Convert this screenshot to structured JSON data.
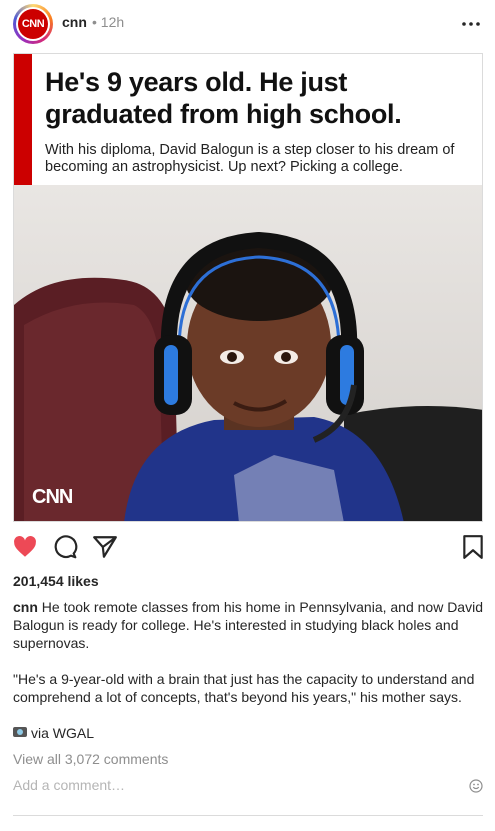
{
  "post": {
    "avatar_text": "CNN",
    "username": "cnn",
    "time": "• 12h"
  },
  "media": {
    "headline": "He's 9 years old. He just graduated from high school.",
    "subhead": "With his diploma, David Balogun is a step closer to his dream of becoming an astrophysicist. Up next? Picking a college.",
    "watermark": "CNN"
  },
  "actions": {
    "liked": true,
    "like_color": "#ed4956"
  },
  "likes": "201,454 likes",
  "caption": {
    "username": "cnn",
    "text": "He took remote classes from his home in Pennsylvania, and now David Balogun is ready for college. He's interested in studying black holes and supernovas.",
    "quote": "\"He's a 9-year-old with a brain that just has the capacity to understand and comprehend a lot of concepts, that's beyond his years,\" his mother says.",
    "credit": "via WGAL"
  },
  "comments": {
    "view_all": "View all 3,072 comments",
    "placeholder": "Add a comment…"
  }
}
